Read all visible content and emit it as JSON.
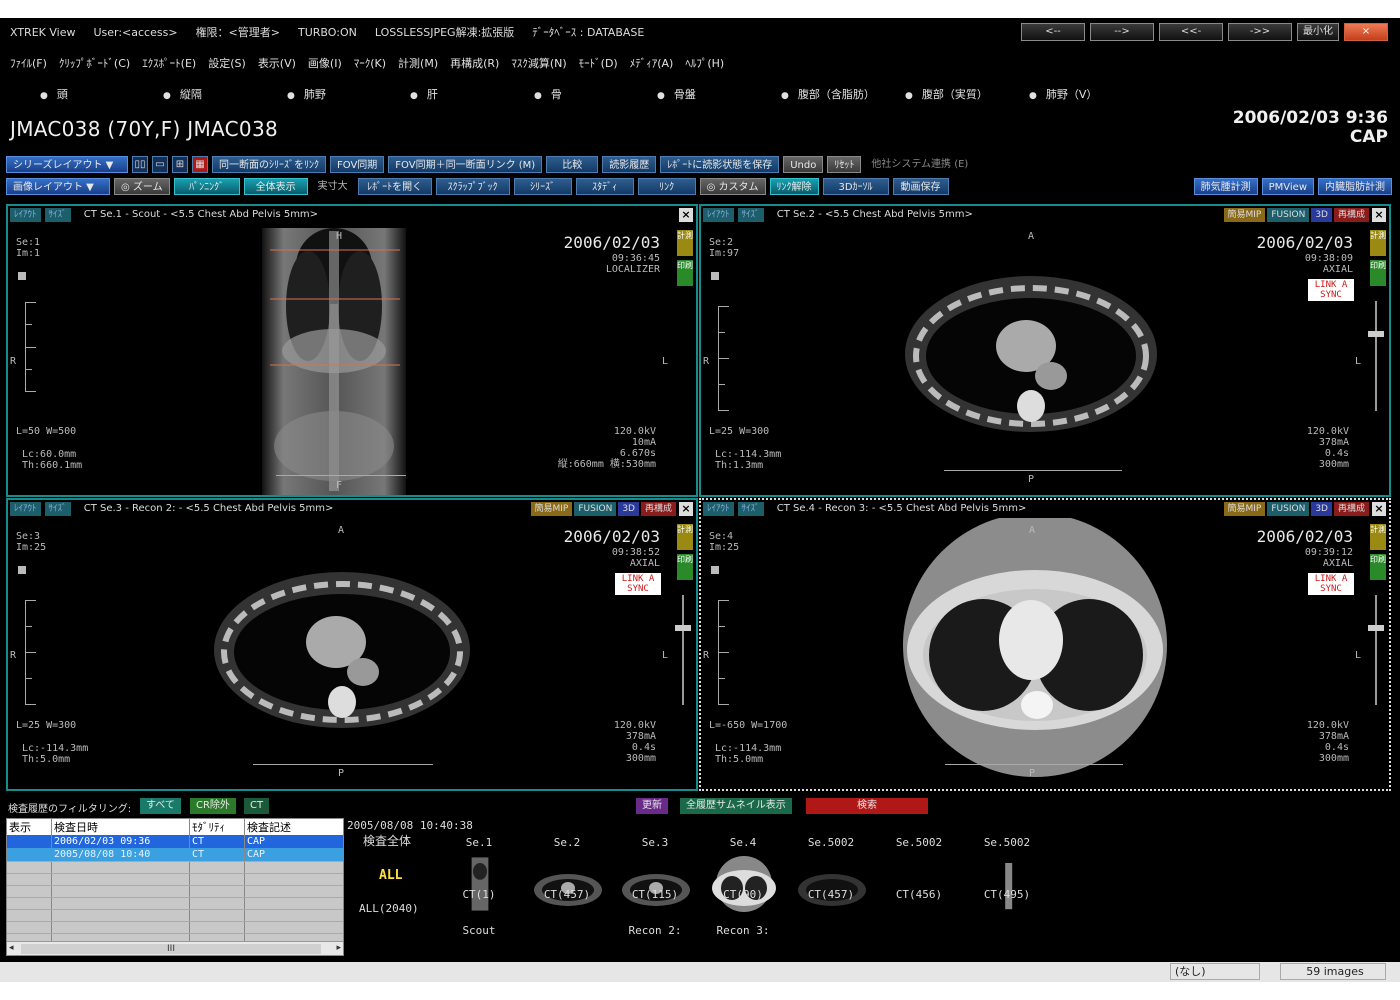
{
  "titlebar": {
    "app": "XTREK View",
    "user": "User:<access>",
    "auth": "権限：<管理者>",
    "turbo": "TURBO:ON",
    "jpeg": "LOSSLESSJPEG解凍:拡張版",
    "db": "ﾃﾞｰﾀﾍﾞｰｽ : DATABASE",
    "nav": [
      "<--",
      "-->",
      "<<-",
      "->>"
    ],
    "minimize": "最小化",
    "close": "×"
  },
  "menu": [
    "ﾌｧｲﾙ(F)",
    "ｸﾘｯﾌﾟﾎﾞｰﾄﾞ(C)",
    "ｴｸｽﾎﾟｰﾄ(E)",
    "設定(S)",
    "表示(V)",
    "画像(I)",
    "ﾏｰｸ(K)",
    "計測(M)",
    "再構成(R)",
    "ﾏｽｸ減算(N)",
    "ﾓｰﾄﾞ(D)",
    "ﾒﾃﾞｨｱ(A)",
    "ﾍﾙﾌﾟ(H)"
  ],
  "organs": [
    "頭",
    "縦隔",
    "肺野",
    "肝",
    "骨",
    "骨盤",
    "腹部（含脂肪）",
    "腹部（実質）",
    "肺野（V）"
  ],
  "patient": "JMAC038 (70Y,F)  JMAC038",
  "study": {
    "date": "2006/02/03 9:36",
    "modality": "CAP"
  },
  "toolbar1": {
    "series_layout": "シリーズレイアウト ▼",
    "link": "同一断面のｼﾘｰｽﾞをﾘﾝｸ",
    "fov": "FOV同期",
    "fov_link": "FOV同期＋同一断面リンク (M)",
    "compare": "比較",
    "reading_history": "読影履歴",
    "save_report": "ﾚﾎﾟｰﾄに読影状態を保存",
    "undo": "Undo",
    "reset": "ﾘｾｯﾄ",
    "ext": "他社システム連携 (E)"
  },
  "toolbar2": {
    "image_layout": "画像レイアウト ▼",
    "zoom": "◎ ズーム",
    "panning": "ﾊﾟﾝﾆﾝｸﾞ",
    "fit": "全体表示",
    "actual": "実寸大",
    "open_report": "ﾚﾎﾟｰﾄを開く",
    "scrapbook": "ｽｸﾗｯﾌﾟﾌﾞｯｸ",
    "series": "ｼﾘｰｽﾞ",
    "study": "ｽﾀﾃﾞｨ",
    "link": "ﾘﾝｸ",
    "custom": "◎ カスタム",
    "unlink": "ﾘﾝｸ解除",
    "curve3d": "3Dｶｰｿﾙ",
    "video_save": "動画保存"
  },
  "toolbar_right": [
    "肺気腫計測",
    "PMView",
    "内臓脂肪計測"
  ],
  "pane_tags": [
    "ﾚｲｱｳﾄ",
    "ｻｲｽﾞ"
  ],
  "pane_btns": [
    "簡易MIP",
    "FUSION",
    "3D",
    "再構成"
  ],
  "side_btns": [
    "計測",
    "印刷"
  ],
  "panes": [
    {
      "title": "CT Se.1  -  Scout  -  <5.5 Chest Abd Pelvis 5mm>",
      "se": "Se:1",
      "im": "Im:1",
      "date": "2006/02/03",
      "time": "09:36:45",
      "kind": "LOCALIZER",
      "wlww": "L=50 W=500",
      "lc": "Lc:60.0mm",
      "th": "Th:660.1mm",
      "kv": "120.0kV",
      "ma": "10mA",
      "s": "6.670s",
      "extra": "縦:660mm 横:530mm",
      "top": "H",
      "bottom": "F",
      "left": "R",
      "right": "L"
    },
    {
      "title": "CT Se.2  -  <5.5 Chest Abd Pelvis 5mm>",
      "se": "Se:2",
      "im": "Im:97",
      "date": "2006/02/03",
      "time": "09:38:09",
      "kind": "AXIAL",
      "wlww": "L=25 W=300",
      "lc": "Lc:-114.3mm",
      "th": "Th:1.3mm",
      "kv": "120.0kV",
      "ma": "378mA",
      "s": "0.4s",
      "extra": "300mm",
      "sync": "LINK A SYNC",
      "top": "A",
      "bottom": "P",
      "left": "R",
      "right": "L"
    },
    {
      "title": "CT Se.3  -  Recon 2:  -  <5.5 Chest Abd Pelvis 5mm>",
      "se": "Se:3",
      "im": "Im:25",
      "date": "2006/02/03",
      "time": "09:38:52",
      "kind": "AXIAL",
      "wlww": "L=25 W=300",
      "lc": "Lc:-114.3mm",
      "th": "Th:5.0mm",
      "kv": "120.0kV",
      "ma": "378mA",
      "s": "0.4s",
      "extra": "300mm",
      "sync": "LINK A SYNC",
      "top": "A",
      "bottom": "P",
      "left": "R",
      "right": "L"
    },
    {
      "title": "CT Se.4  -  Recon 3:  -  <5.5 Chest Abd Pelvis 5mm>",
      "se": "Se:4",
      "im": "Im:25",
      "date": "2006/02/03",
      "time": "09:39:12",
      "kind": "AXIAL",
      "wlww": "L=-650 W=1700",
      "lc": "Lc:-114.3mm",
      "th": "Th:5.0mm",
      "kv": "120.0kV",
      "ma": "378mA",
      "s": "0.4s",
      "extra": "300mm",
      "sync": "LINK A SYNC",
      "top": "A",
      "bottom": "P",
      "left": "R",
      "right": "L"
    }
  ],
  "history": {
    "label": "検査履歴のフィルタリング:",
    "all": "すべて",
    "cr": "CR除外",
    "ct": "CT",
    "update": "更新",
    "thumbs": "全履歴サムネイル表示",
    "search": "検索"
  },
  "table": {
    "headers": [
      "表示",
      "検査日時",
      "ﾓﾀﾞﾘﾃｨ",
      "検査記述"
    ],
    "rows": [
      [
        "",
        "2006/02/03  09:36",
        "CT",
        "CAP"
      ],
      [
        "",
        "2005/08/08  10:40",
        "CT",
        "CAP"
      ]
    ],
    "scroll": "III"
  },
  "thumbs": {
    "datetime": "2005/08/08 10:40:38",
    "all_title": "検査全体",
    "all_label": "ALL",
    "all_count": "ALL(2040)",
    "items": [
      {
        "se": "Se.1",
        "count": "CT(1)",
        "name": "Scout"
      },
      {
        "se": "Se.2",
        "count": "CT(457)",
        "name": ""
      },
      {
        "se": "Se.3",
        "count": "CT(115)",
        "name": "Recon 2:"
      },
      {
        "se": "Se.4",
        "count": "CT(90)",
        "name": "Recon 3:"
      },
      {
        "se": "Se.5002",
        "count": "CT(457)",
        "name": ""
      },
      {
        "se": "Se.5002",
        "count": "CT(456)",
        "name": ""
      },
      {
        "se": "Se.5002",
        "count": "CT(495)",
        "name": ""
      }
    ]
  },
  "status": {
    "none": "(なし)",
    "images": "59 images"
  }
}
